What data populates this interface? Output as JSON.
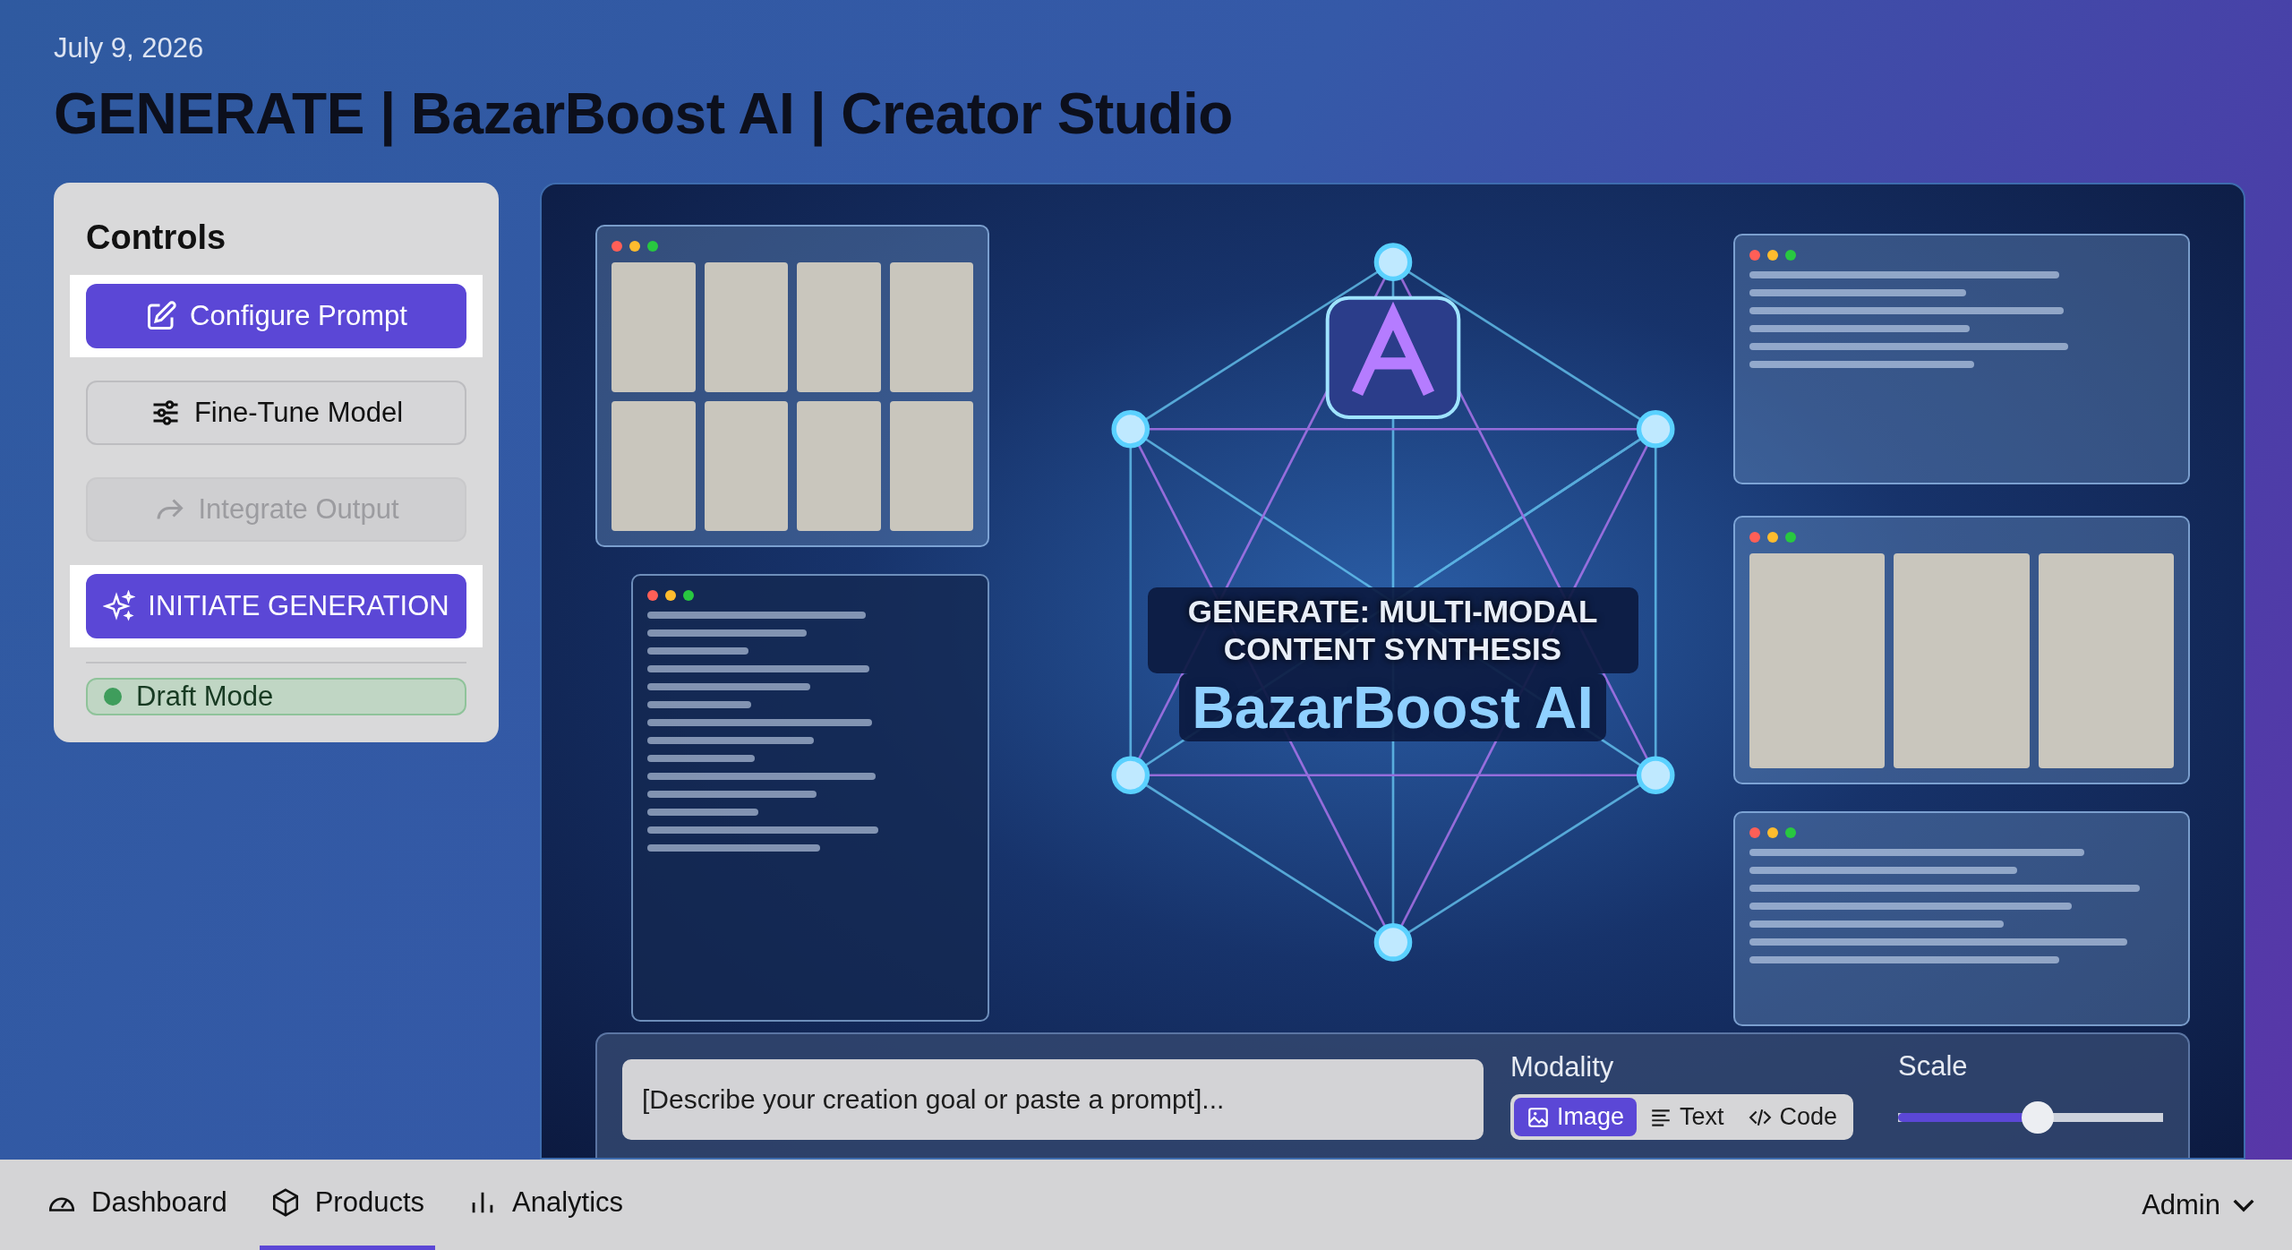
{
  "header": {
    "date": "July 9, 2026",
    "title": "GENERATE | BazarBoost AI | Creator Studio"
  },
  "controls": {
    "title": "Controls",
    "buttons": [
      {
        "label": "Configure Prompt",
        "kind": "primary",
        "highlighted": true,
        "disabled": false
      },
      {
        "label": "Fine-Tune Model",
        "kind": "secondary",
        "highlighted": false,
        "disabled": false
      },
      {
        "label": "Integrate Output",
        "kind": "secondary",
        "highlighted": false,
        "disabled": true
      },
      {
        "label": "INITIATE GENERATION",
        "kind": "primary",
        "highlighted": true,
        "disabled": false
      }
    ],
    "status": {
      "label": "Draft Mode",
      "color": "#3f9d5c"
    }
  },
  "hero": {
    "headline": "GENERATE: MULTI-MODAL CONTENT SYNTHESIS",
    "brand": "BazarBoost AI"
  },
  "prompt": {
    "placeholder": "[Describe your creation goal or paste a prompt]..."
  },
  "modality": {
    "label": "Modality",
    "options": [
      {
        "label": "Image",
        "selected": true
      },
      {
        "label": "Text",
        "selected": false
      },
      {
        "label": "Code",
        "selected": false
      }
    ]
  },
  "scale": {
    "label": "Scale",
    "level": 0.53
  },
  "nav": {
    "tabs": [
      {
        "label": "Dashboard",
        "selected": false
      },
      {
        "label": "Products",
        "selected": true
      },
      {
        "label": "Analytics",
        "selected": false
      }
    ],
    "user": "Admin"
  }
}
